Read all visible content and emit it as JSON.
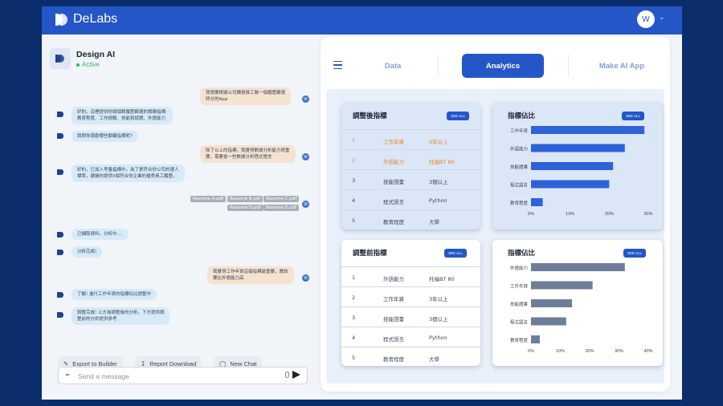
{
  "app": {
    "name": "DeLabs",
    "user_initial": "W"
  },
  "chat": {
    "title": "Design AI",
    "status": "Active",
    "messages": [
      {
        "role": "user",
        "lines": [
          "我想要根據公司擴張員工做一個履歷篩選",
          "評分的App"
        ]
      },
      {
        "role": "bot",
        "lines": [
          "好的。這裡提供你總個範履歷篩選的關鍵指標:",
          "教育程度、工作經驗、技能和認證、外語能力"
        ]
      },
      {
        "role": "bot",
        "lines": [
          "請問你喜歡哪些關鍵指標呢?"
        ]
      },
      {
        "role": "user",
        "lines": [
          "除了以上的指標，我覺得數據分析能力很重",
          "要，需要會一些數據分析程式語言"
        ]
      },
      {
        "role": "bot",
        "lines": [
          "好的，已加入考量指標中。為了更符合你公司的選人",
          "標準，建議你提供5個符合你企業的優秀員工履歷。"
        ]
      },
      {
        "role": "bot",
        "lines": [
          "已擷取資料，分析中...."
        ]
      },
      {
        "role": "bot",
        "lines": [
          "分析完成!"
        ]
      },
      {
        "role": "user",
        "lines": [
          "我覺得工作年資這個指標最重要，應該",
          "要比外語能力高"
        ]
      },
      {
        "role": "bot",
        "lines": [
          "了解! 進行工作年資的指標佔比調整中"
        ]
      },
      {
        "role": "bot",
        "lines": [
          "調整完成! 上方為調整後的分析，下方提供調",
          "整前的分析提供參考"
        ]
      }
    ],
    "files": [
      "Resume A.pdf",
      "Resume B.pdf",
      "Resume C.pdf",
      "Resume D.pdf",
      "Resume E.pdf"
    ],
    "actions": {
      "export": "Export to Builder",
      "report": "Report Download",
      "new_chat": "New Chat"
    },
    "input_placeholder": "Send a message"
  },
  "tabs": [
    {
      "label": "Data",
      "active": false
    },
    {
      "label": "Analytics",
      "active": true
    },
    {
      "label": "Make AI App",
      "active": false
    }
  ],
  "see_all_label": "SEE ALL",
  "after_table": {
    "title": "調整後指標",
    "rows": [
      {
        "rank": "1",
        "metric": "工作年資",
        "value": "3年以上",
        "highlight": true
      },
      {
        "rank": "2",
        "metric": "外語能力",
        "value": "托福BT 80",
        "highlight": true
      },
      {
        "rank": "3",
        "metric": "技能證書",
        "value": "3個以上",
        "highlight": false
      },
      {
        "rank": "4",
        "metric": "程式語言",
        "value": "Python",
        "highlight": false
      },
      {
        "rank": "5",
        "metric": "教育程度",
        "value": "大學",
        "highlight": false
      }
    ]
  },
  "before_table": {
    "title": "調整前指標",
    "rows": [
      {
        "rank": "1",
        "metric": "外語能力",
        "value": "托福BT 80"
      },
      {
        "rank": "2",
        "metric": "工作年資",
        "value": "3年以上"
      },
      {
        "rank": "3",
        "metric": "技能證書",
        "value": "3個以上"
      },
      {
        "rank": "4",
        "metric": "程式語言",
        "value": "Python"
      },
      {
        "rank": "5",
        "metric": "教育程度",
        "value": "大學"
      }
    ]
  },
  "chart_data": [
    {
      "type": "bar",
      "orientation": "horizontal",
      "title": "指標佔比",
      "categories": [
        "工作年資",
        "外語能力",
        "技能證書",
        "程式語言",
        "教育程度"
      ],
      "values": [
        29,
        24,
        21,
        20,
        3
      ],
      "xticks": [
        "0%",
        "10%",
        "20%",
        "30%"
      ],
      "xlim": [
        0,
        30
      ],
      "color": "#2d62d8"
    },
    {
      "type": "bar",
      "orientation": "horizontal",
      "title": "指標佔比",
      "categories": [
        "外語能力",
        "工作年資",
        "技能證書",
        "程式語言",
        "教育程度"
      ],
      "values": [
        32,
        21,
        14,
        12,
        3
      ],
      "xticks": [
        "0%",
        "10%",
        "20%",
        "30%",
        "40%"
      ],
      "xlim": [
        0,
        40
      ],
      "color": "#6e7e99"
    }
  ]
}
